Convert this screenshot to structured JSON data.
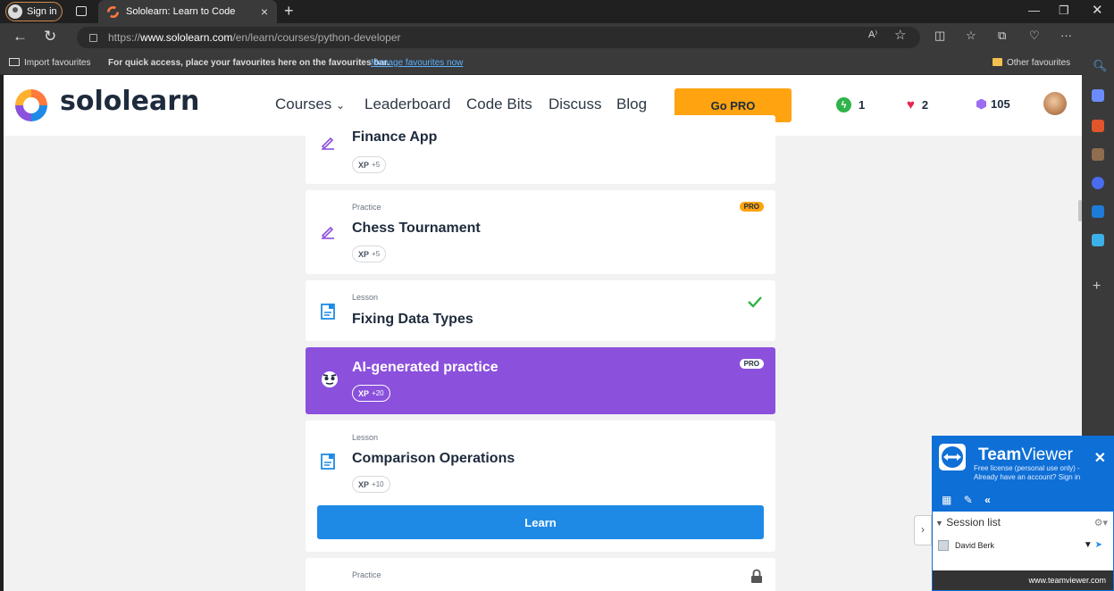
{
  "browser": {
    "sign_in": "Sign in",
    "tab_title": "Sololearn: Learn to Code",
    "url_prefix": "https://",
    "url_domain": "www.sololearn.com",
    "url_path": "/en/learn/courses/python-developer",
    "favbar": {
      "import": "Import favourites",
      "hint": "For quick access, place your favourites here on the favourites bar.",
      "manage_link": "Manage favourites now",
      "other": "Other favourites"
    }
  },
  "header": {
    "brand": "sololearn",
    "nav": {
      "courses": "Courses",
      "leaderboard": "Leaderboard",
      "code_bits": "Code Bits",
      "discuss": "Discuss",
      "blog": "Blog"
    },
    "go_pro": "Go PRO",
    "streak": "1",
    "hearts": "2",
    "gems": "105"
  },
  "cards": [
    {
      "kind": "",
      "title": "Finance App",
      "xp_label": "XP",
      "xp": "+5"
    },
    {
      "kind": "Practice",
      "title": "Chess Tournament",
      "xp_label": "XP",
      "xp": "+5",
      "badge": "PRO"
    },
    {
      "kind": "Lesson",
      "title": "Fixing Data Types"
    },
    {
      "kind": "",
      "title": "AI-generated practice",
      "xp_label": "XP",
      "xp": "+20",
      "badge": "PRO"
    },
    {
      "kind": "Lesson",
      "title": "Comparison Operations",
      "xp_label": "XP",
      "xp": "+10",
      "button": "Learn"
    },
    {
      "kind": "Practice",
      "title": ""
    }
  ],
  "teamviewer": {
    "name_bold": "Team",
    "name_rest": "Viewer",
    "line1": "Free license (personal use only) -",
    "line2": "Already have an account? Sign in",
    "session_list": "Session list",
    "user": "David Berk",
    "footer": "www.teamviewer.com"
  },
  "colors": {
    "pro_orange": "#ffa310",
    "ai_purple": "#8b50dc",
    "learn_blue": "#1e8ae6",
    "teamviewer_blue": "#0e6fd7"
  }
}
